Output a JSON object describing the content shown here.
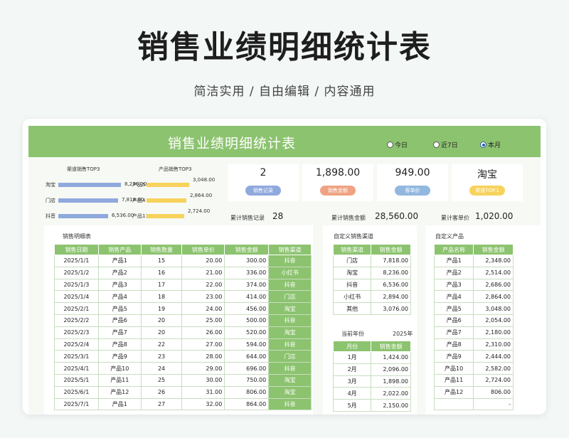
{
  "page": {
    "title": "销售业绩明细统计表",
    "subtitle": "简洁实用 / 自由编辑 / 内容通用"
  },
  "sheet": {
    "title": "销售业绩明细统计表",
    "radios": [
      {
        "label": "今日",
        "checked": false
      },
      {
        "label": "近7日",
        "checked": false
      },
      {
        "label": "本月",
        "checked": true
      }
    ]
  },
  "mini_charts": {
    "channel": {
      "title": "渠道销售TOP3",
      "items": [
        {
          "label": "淘宝",
          "value": "8,236.00",
          "pct": 1.0
        },
        {
          "label": "门店",
          "value": "7,818.00",
          "pct": 0.95
        },
        {
          "label": "抖音",
          "value": "6,536.00",
          "pct": 0.79
        }
      ],
      "color": "#8fa9dd"
    },
    "product": {
      "title": "产品销售TOP3",
      "items": [
        {
          "label": "产品5",
          "value": "3,048.00",
          "pct": 1.0
        },
        {
          "label": "产品4",
          "value": "2,864.00",
          "pct": 0.94
        },
        {
          "label": "产品11",
          "value": "2,724.00",
          "pct": 0.89
        }
      ],
      "color": "#f7d25c"
    }
  },
  "kpis": [
    {
      "value": "2",
      "label": "销售记录",
      "color": "#8fa9dd"
    },
    {
      "value": "1,898.00",
      "label": "销售金额",
      "color": "#f0a383"
    },
    {
      "value": "949.00",
      "label": "客单价",
      "color": "#92b8e0"
    },
    {
      "value": "淘宝",
      "label": "渠道TOP.1",
      "color": "#f7d25c"
    }
  ],
  "totals": [
    {
      "label": "累计销售记录",
      "value": "28"
    },
    {
      "label": "累计销售金额",
      "value": "28,560.00"
    },
    {
      "label": "累计客单价",
      "value": "1,020.00"
    }
  ],
  "detail": {
    "title": "销售明细表",
    "headers": [
      "销售日期",
      "销售产品",
      "销售数量",
      "销售单价",
      "销售金额",
      "销售渠道"
    ],
    "rows": [
      [
        "2025/1/1",
        "产品1",
        "15",
        "20.00",
        "300.00",
        "抖音"
      ],
      [
        "2025/1/2",
        "产品2",
        "16",
        "21.00",
        "336.00",
        "小红书"
      ],
      [
        "2025/1/3",
        "产品3",
        "17",
        "22.00",
        "374.00",
        "抖音"
      ],
      [
        "2025/1/4",
        "产品4",
        "18",
        "23.00",
        "414.00",
        "门店"
      ],
      [
        "2025/2/1",
        "产品5",
        "19",
        "24.00",
        "456.00",
        "淘宝"
      ],
      [
        "2025/2/2",
        "产品6",
        "20",
        "25.00",
        "500.00",
        "抖音"
      ],
      [
        "2025/2/3",
        "产品7",
        "20",
        "26.00",
        "520.00",
        "淘宝"
      ],
      [
        "2025/2/4",
        "产品8",
        "22",
        "27.00",
        "594.00",
        "抖音"
      ],
      [
        "2025/3/1",
        "产品9",
        "23",
        "28.00",
        "644.00",
        "门店"
      ],
      [
        "2025/4/1",
        "产品10",
        "24",
        "29.00",
        "696.00",
        "抖音"
      ],
      [
        "2025/5/1",
        "产品11",
        "25",
        "30.00",
        "750.00",
        "淘宝"
      ],
      [
        "2025/6/1",
        "产品12",
        "26",
        "31.00",
        "806.00",
        "淘宝"
      ],
      [
        "2025/7/1",
        "产品1",
        "27",
        "32.00",
        "864.00",
        "抖音"
      ]
    ]
  },
  "channel_table": {
    "title": "自定义销售渠道",
    "headers": [
      "销售渠道",
      "销售金额"
    ],
    "rows": [
      [
        "门店",
        "7,818.00"
      ],
      [
        "淘宝",
        "8,236.00"
      ],
      [
        "抖音",
        "6,536.00"
      ],
      [
        "小红书",
        "2,894.00"
      ],
      [
        "其他",
        "3,076.00"
      ]
    ]
  },
  "year": {
    "label": "当前年份",
    "value": "2025年"
  },
  "month_table": {
    "headers": [
      "月份",
      "销售金额"
    ],
    "rows": [
      [
        "1月",
        "1,424.00"
      ],
      [
        "2月",
        "2,096.00"
      ],
      [
        "3月",
        "1,898.00"
      ],
      [
        "4月",
        "2,022.00"
      ],
      [
        "5月",
        "2,150.00"
      ]
    ]
  },
  "product_table": {
    "title": "自定义产品",
    "headers": [
      "产品名称",
      "销售金额"
    ],
    "rows": [
      [
        "产品1",
        "2,348.00"
      ],
      [
        "产品2",
        "2,514.00"
      ],
      [
        "产品3",
        "2,686.00"
      ],
      [
        "产品4",
        "2,864.00"
      ],
      [
        "产品5",
        "3,048.00"
      ],
      [
        "产品6",
        "2,054.00"
      ],
      [
        "产品7",
        "2,180.00"
      ],
      [
        "产品8",
        "2,310.00"
      ],
      [
        "产品9",
        "2,444.00"
      ],
      [
        "产品10",
        "2,582.00"
      ],
      [
        "产品11",
        "2,724.00"
      ],
      [
        "产品12",
        "806.00"
      ],
      [
        "",
        "-"
      ]
    ]
  }
}
